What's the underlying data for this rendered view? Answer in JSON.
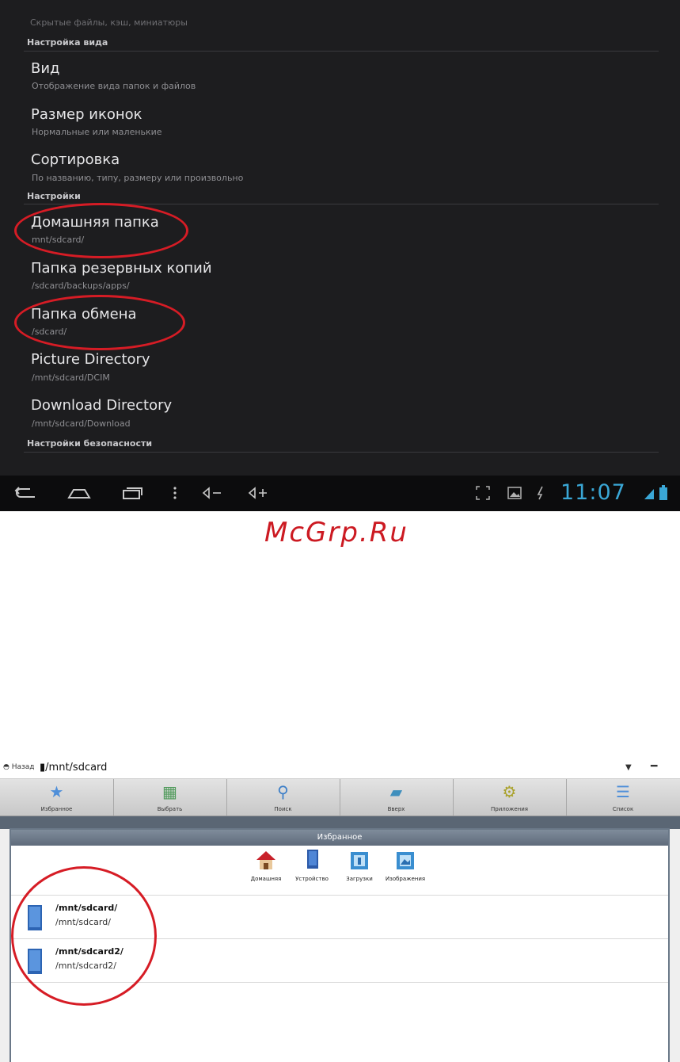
{
  "settings": {
    "cut_off_text": "Скрытые файлы, кэш, миниатюры",
    "sections": [
      {
        "header": "Настройка вида"
      },
      {
        "header": "Настройки"
      },
      {
        "header": "Настройки безопасности"
      }
    ],
    "items": [
      {
        "title": "Вид",
        "subtitle": "Отображение вида папок и файлов"
      },
      {
        "title": "Размер иконок",
        "subtitle": "Нормальные или маленькие"
      },
      {
        "title": "Сортировка",
        "subtitle": "По названию, типу, размеру или произвольно"
      },
      {
        "title": "Домашняя папка",
        "subtitle": "mnt/sdcard/"
      },
      {
        "title": "Папка резервных копий",
        "subtitle": "/sdcard/backups/apps/"
      },
      {
        "title": "Папка обмена",
        "subtitle": "/sdcard/"
      },
      {
        "title": "Picture Directory",
        "subtitle": "/mnt/sdcard/DCIM"
      },
      {
        "title": "Download Directory",
        "subtitle": "/mnt/sdcard/Download"
      }
    ]
  },
  "system_bar": {
    "clock": "11:07",
    "icons": [
      "back-icon",
      "home-icon",
      "recent-apps-icon",
      "menu-icon",
      "volume-down-icon",
      "volume-up-icon",
      "screenshot-icon",
      "gallery-icon",
      "signal-icon",
      "battery-icon"
    ],
    "accent_color": "#3aa7d6"
  },
  "watermark": "McGrp.Ru",
  "file_manager": {
    "back_label": "Назад",
    "path": "/mnt/sdcard",
    "toolbar": [
      {
        "label": "Избранное",
        "icon": "star-icon"
      },
      {
        "label": "Выбрать",
        "icon": "grid-select-icon"
      },
      {
        "label": "Поиск",
        "icon": "search-icon"
      },
      {
        "label": "Вверх",
        "icon": "folder-up-icon"
      },
      {
        "label": "Приложения",
        "icon": "apps-gear-icon"
      },
      {
        "label": "Список",
        "icon": "list-icon"
      }
    ],
    "dialog": {
      "title": "Избранное",
      "quick_items": [
        {
          "label": "Домашняя",
          "icon": "house-icon"
        },
        {
          "label": "Устройство",
          "icon": "device-icon"
        },
        {
          "label": "Загрузки",
          "icon": "downloads-icon"
        },
        {
          "label": "Изображения",
          "icon": "pictures-icon"
        }
      ],
      "favorites": [
        {
          "name": "/mnt/sdcard/",
          "path": "/mnt/sdcard/"
        },
        {
          "name": "/mnt/sdcard2/",
          "path": "/mnt/sdcard2/"
        }
      ]
    }
  },
  "highlight_color": "#d61c25"
}
